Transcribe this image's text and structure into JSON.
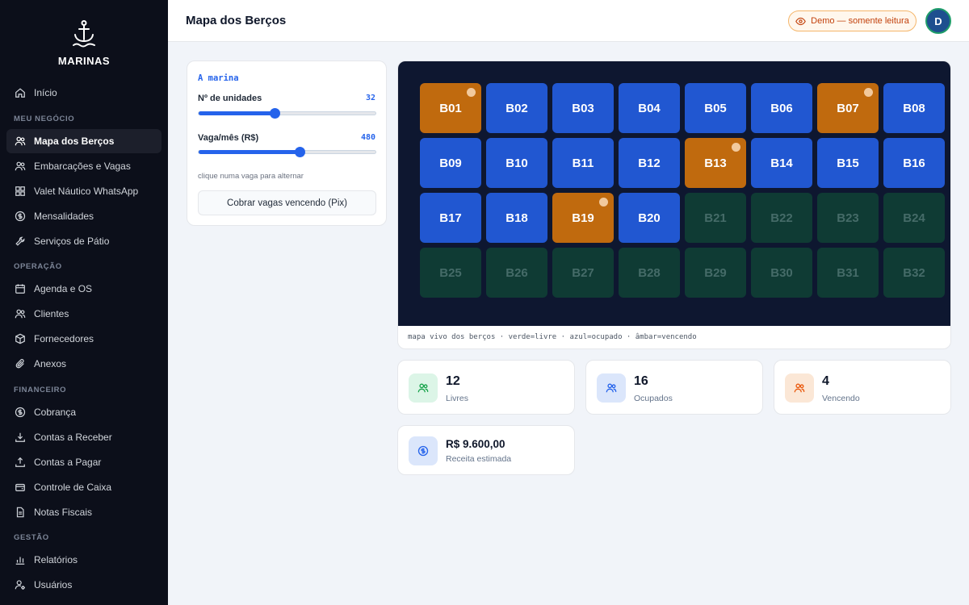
{
  "brand": {
    "name": "MARINAS",
    "logo_icon": "anchor-icon"
  },
  "header": {
    "title": "Mapa dos Berços",
    "demo_badge": "Demo — somente leitura",
    "avatar_initial": "D"
  },
  "sidebar": {
    "sections": [
      "MEU NEGÓCIO",
      "OPERAÇÃO",
      "FINANCEIRO",
      "GESTÃO"
    ],
    "items": [
      {
        "label": "Início",
        "icon": "home-icon"
      },
      {
        "label": "Mapa dos Berços",
        "icon": "users-icon",
        "active": true
      },
      {
        "label": "Embarcações e Vagas",
        "icon": "users-icon"
      },
      {
        "label": "Valet Náutico WhatsApp",
        "icon": "grid-icon"
      },
      {
        "label": "Mensalidades",
        "icon": "dollar-circle-icon"
      },
      {
        "label": "Serviços de Pátio",
        "icon": "wrench-icon"
      },
      {
        "label": "Agenda e OS",
        "icon": "calendar-icon"
      },
      {
        "label": "Clientes",
        "icon": "users-icon"
      },
      {
        "label": "Fornecedores",
        "icon": "box-icon"
      },
      {
        "label": "Anexos",
        "icon": "paperclip-icon"
      },
      {
        "label": "Cobrança",
        "icon": "dollar-circle-icon"
      },
      {
        "label": "Contas a Receber",
        "icon": "download-icon"
      },
      {
        "label": "Contas a Pagar",
        "icon": "upload-icon"
      },
      {
        "label": "Controle de Caixa",
        "icon": "wallet-icon"
      },
      {
        "label": "Notas Fiscais",
        "icon": "file-icon"
      },
      {
        "label": "Relatórios",
        "icon": "bar-chart-icon"
      },
      {
        "label": "Usuários",
        "icon": "user-gear-icon"
      }
    ]
  },
  "settings": {
    "title": "A marina",
    "units_label": "Nº de unidades",
    "units_value": "32",
    "units_slider_fraction": 0.43,
    "price_label": "Vaga/mês (R$)",
    "price_value": "480",
    "price_slider_fraction": 0.57,
    "hint": "clique numa vaga para alternar",
    "charge_button": "Cobrar vagas vencendo (Pix)"
  },
  "berth_map": {
    "caption": "mapa vivo dos berços · verde=livre · azul=ocupado · âmbar=vencendo",
    "berths": [
      {
        "id": "B01",
        "status": "expiring"
      },
      {
        "id": "B02",
        "status": "occupied"
      },
      {
        "id": "B03",
        "status": "occupied"
      },
      {
        "id": "B04",
        "status": "occupied"
      },
      {
        "id": "B05",
        "status": "occupied"
      },
      {
        "id": "B06",
        "status": "occupied"
      },
      {
        "id": "B07",
        "status": "expiring"
      },
      {
        "id": "B08",
        "status": "occupied"
      },
      {
        "id": "B09",
        "status": "occupied"
      },
      {
        "id": "B10",
        "status": "occupied"
      },
      {
        "id": "B11",
        "status": "occupied"
      },
      {
        "id": "B12",
        "status": "occupied"
      },
      {
        "id": "B13",
        "status": "expiring"
      },
      {
        "id": "B14",
        "status": "occupied"
      },
      {
        "id": "B15",
        "status": "occupied"
      },
      {
        "id": "B16",
        "status": "occupied"
      },
      {
        "id": "B17",
        "status": "occupied"
      },
      {
        "id": "B18",
        "status": "occupied"
      },
      {
        "id": "B19",
        "status": "expiring"
      },
      {
        "id": "B20",
        "status": "occupied"
      },
      {
        "id": "B21",
        "status": "free"
      },
      {
        "id": "B22",
        "status": "free"
      },
      {
        "id": "B23",
        "status": "free"
      },
      {
        "id": "B24",
        "status": "free"
      },
      {
        "id": "B25",
        "status": "free"
      },
      {
        "id": "B26",
        "status": "free"
      },
      {
        "id": "B27",
        "status": "free"
      },
      {
        "id": "B28",
        "status": "free"
      },
      {
        "id": "B29",
        "status": "free"
      },
      {
        "id": "B30",
        "status": "free"
      },
      {
        "id": "B31",
        "status": "free"
      },
      {
        "id": "B32",
        "status": "free"
      }
    ],
    "colors": {
      "free": "#0f3b34",
      "occupied": "#2157d1",
      "expiring": "#c06a0e"
    }
  },
  "stats": {
    "free": {
      "value": "12",
      "label": "Livres",
      "icon": "users-icon",
      "color": "#16a34a"
    },
    "occupied": {
      "value": "16",
      "label": "Ocupados",
      "icon": "users-icon",
      "color": "#2563eb"
    },
    "expiring": {
      "value": "4",
      "label": "Vencendo",
      "icon": "users-icon",
      "color": "#ea580c"
    },
    "revenue": {
      "value": "R$ 9.600,00",
      "label": "Receita estimada",
      "icon": "dollar-circle-icon",
      "color": "#2563eb"
    }
  }
}
